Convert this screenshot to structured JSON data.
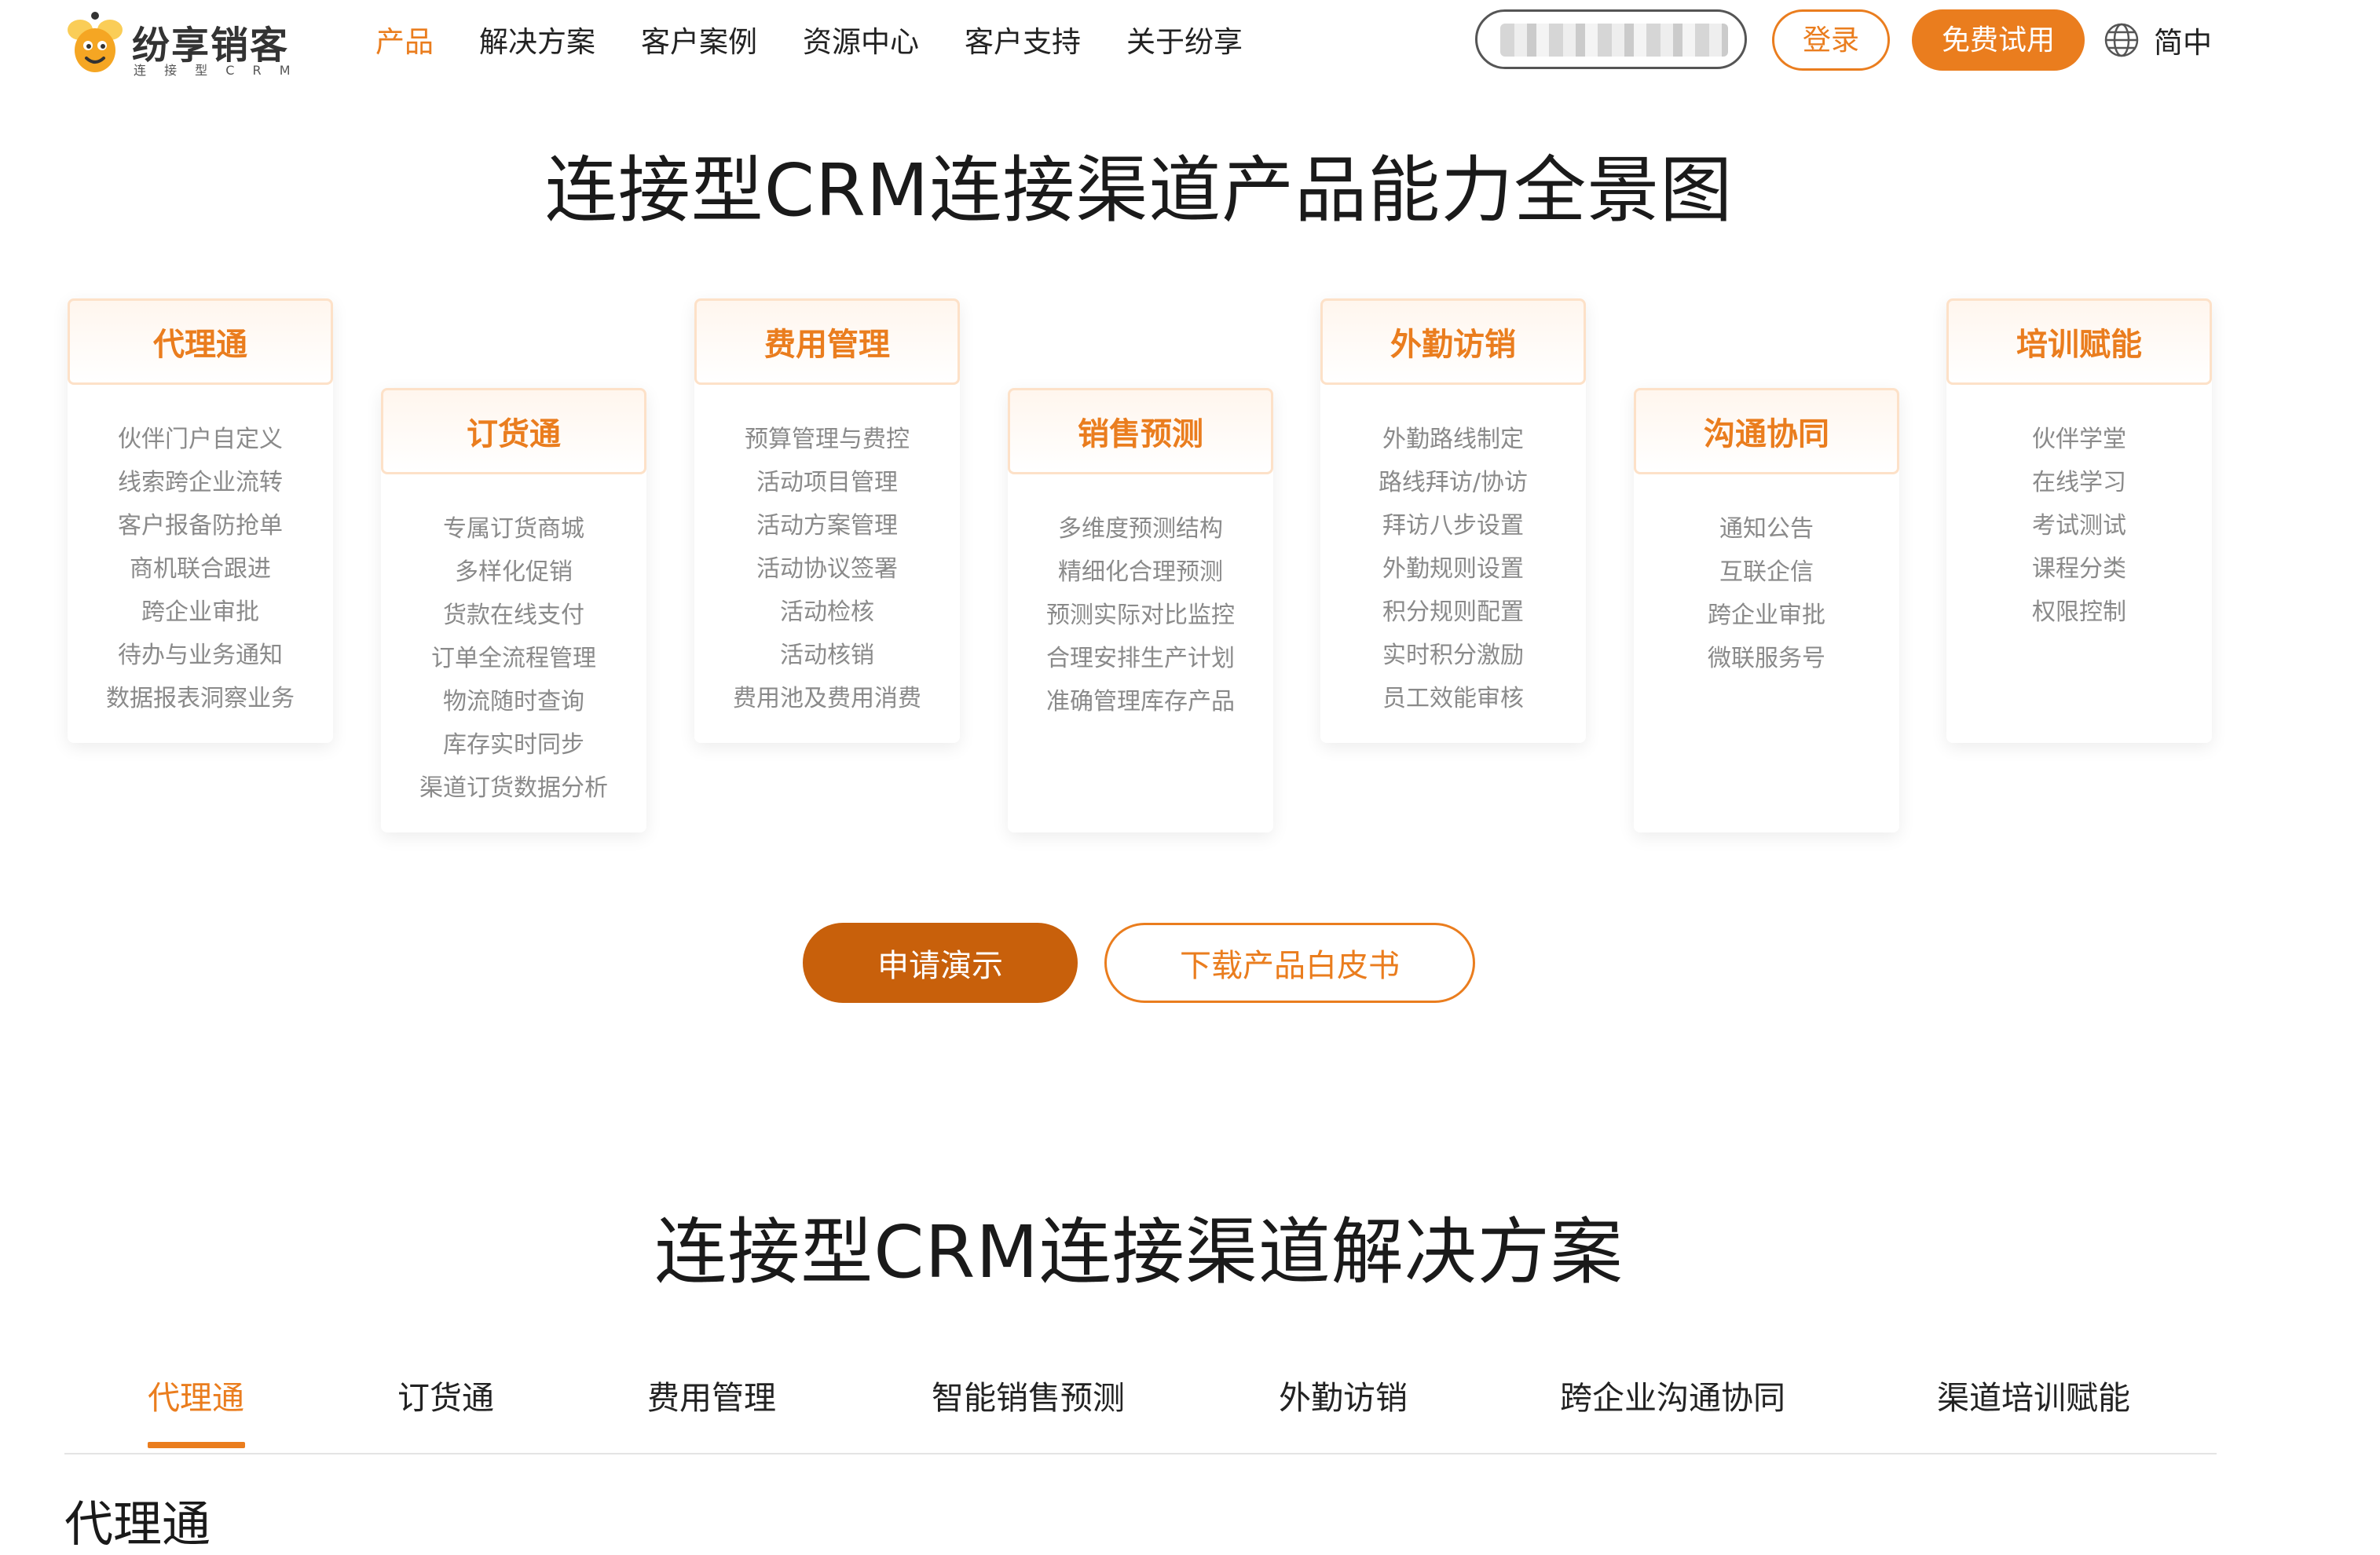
{
  "header": {
    "logo": {
      "name": "纷享销客",
      "subtitle": "连 接 型 C R M"
    },
    "nav": [
      "产品",
      "解决方案",
      "客户案例",
      "资源中心",
      "客户支持",
      "关于纷享"
    ],
    "search": {
      "value": "",
      "placeholder": ""
    },
    "login_label": "登录",
    "trial_label": "免费试用",
    "language_label": "简中"
  },
  "capability_section": {
    "title": "连接型CRM连接渠道产品能力全景图",
    "cards": [
      {
        "title": "代理通",
        "items": [
          "伙伴门户自定义",
          "线索跨企业流转",
          "客户报备防抢单",
          "商机联合跟进",
          "跨企业审批",
          "待办与业务通知",
          "数据报表洞察业务"
        ]
      },
      {
        "title": "订货通",
        "items": [
          "专属订货商城",
          "多样化促销",
          "货款在线支付",
          "订单全流程管理",
          "物流随时查询",
          "库存实时同步",
          "渠道订货数据分析"
        ]
      },
      {
        "title": "费用管理",
        "items": [
          "预算管理与费控",
          "活动项目管理",
          "活动方案管理",
          "活动协议签署",
          "活动检核",
          "活动核销",
          "费用池及费用消费"
        ]
      },
      {
        "title": "销售预测",
        "items": [
          "多维度预测结构",
          "精细化合理预测",
          "预测实际对比监控",
          "合理安排生产计划",
          "准确管理库存产品"
        ]
      },
      {
        "title": "外勤访销",
        "items": [
          "外勤路线制定",
          "路线拜访/协访",
          "拜访八步设置",
          "外勤规则设置",
          "积分规则配置",
          "实时积分激励",
          "员工效能审核"
        ]
      },
      {
        "title": "沟通协同",
        "items": [
          "通知公告",
          "互联企信",
          "跨企业审批",
          "微联服务号"
        ]
      },
      {
        "title": "培训赋能",
        "items": [
          "伙伴学堂",
          "在线学习",
          "考试测试",
          "课程分类",
          "权限控制"
        ]
      }
    ],
    "demo_label": "申请演示",
    "whitepaper_label": "下载产品白皮书"
  },
  "solution_section": {
    "title": "连接型CRM连接渠道解决方案",
    "tabs": [
      "代理通",
      "订货通",
      "费用管理",
      "智能销售预测",
      "外勤访销",
      "跨企业沟通协同",
      "渠道培训赋能"
    ],
    "active_tab": "代理通",
    "content_title": "代理通"
  },
  "colors": {
    "accent": "#ea7d1e",
    "accent_dark": "#c8600b",
    "card_border": "#fde1c8",
    "muted_text": "#8a8a8a"
  }
}
